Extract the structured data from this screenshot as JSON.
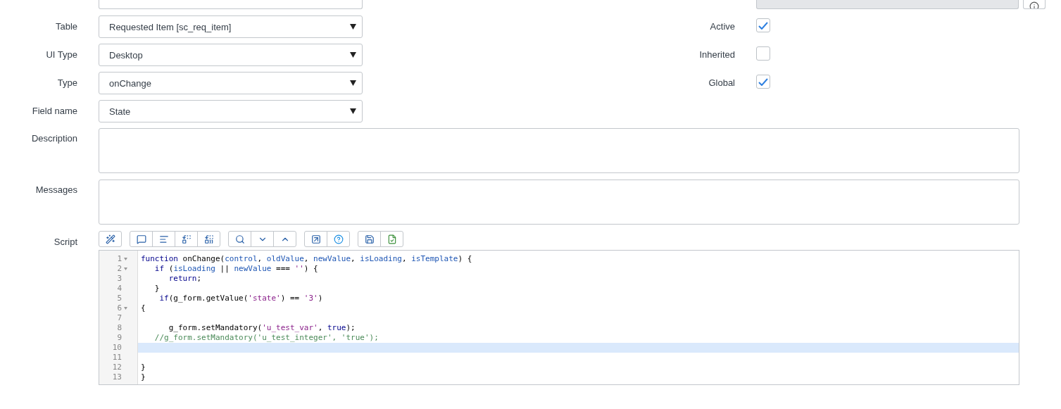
{
  "top_row": {
    "application_field": {
      "disabled": true
    }
  },
  "rows": [
    {
      "label": "Table",
      "select": "Requested Item [sc_req_item]",
      "right": {
        "label": "Active",
        "checked": true
      }
    },
    {
      "label": "UI Type",
      "select": "Desktop",
      "right": {
        "label": "Inherited",
        "checked": false
      }
    },
    {
      "label": "Type",
      "select": "onChange",
      "right": {
        "label": "Global",
        "checked": true
      }
    },
    {
      "label": "Field name",
      "select": "State"
    }
  ],
  "textareas": [
    {
      "label": "Description"
    },
    {
      "label": "Messages"
    }
  ],
  "script": {
    "label": "Script",
    "toolbar": [
      [
        {
          "kind": "format"
        }
      ],
      [
        {
          "kind": "comment"
        },
        {
          "kind": "align"
        },
        {
          "kind": "replace"
        },
        {
          "kind": "replace_all"
        }
      ],
      [
        {
          "kind": "search"
        },
        {
          "kind": "next"
        },
        {
          "kind": "previous"
        }
      ],
      [
        {
          "kind": "fullscreen"
        },
        {
          "kind": "help"
        }
      ],
      [
        {
          "kind": "save"
        },
        {
          "kind": "check"
        }
      ]
    ],
    "lines": [
      {
        "number": "1",
        "fold": true,
        "active": false,
        "tokens": [
          {
            "kind": "keyword",
            "text": "function"
          },
          {
            "kind": "plain",
            "text": " onChange("
          },
          {
            "kind": "var",
            "text": "control"
          },
          {
            "kind": "plain",
            "text": ", "
          },
          {
            "kind": "var",
            "text": "oldValue"
          },
          {
            "kind": "plain",
            "text": ", "
          },
          {
            "kind": "var",
            "text": "newValue"
          },
          {
            "kind": "plain",
            "text": ", "
          },
          {
            "kind": "var",
            "text": "isLoading"
          },
          {
            "kind": "plain",
            "text": ", "
          },
          {
            "kind": "var",
            "text": "isTemplate"
          },
          {
            "kind": "plain",
            "text": ") {"
          }
        ]
      },
      {
        "number": "2",
        "fold": true,
        "active": false,
        "tokens": [
          {
            "kind": "keyword",
            "text": "   if"
          },
          {
            "kind": "plain",
            "text": " ("
          },
          {
            "kind": "var",
            "text": "isLoading"
          },
          {
            "kind": "plain",
            "text": " || "
          },
          {
            "kind": "var",
            "text": "newValue"
          },
          {
            "kind": "plain",
            "text": " === "
          },
          {
            "kind": "string",
            "text": "''"
          },
          {
            "kind": "plain",
            "text": ") {"
          }
        ]
      },
      {
        "number": "3",
        "fold": false,
        "active": false,
        "tokens": [
          {
            "kind": "keyword",
            "text": "      return"
          },
          {
            "kind": "plain",
            "text": ";"
          }
        ]
      },
      {
        "number": "4",
        "fold": false,
        "active": false,
        "tokens": [
          {
            "kind": "plain",
            "text": "   }"
          }
        ]
      },
      {
        "number": "5",
        "fold": false,
        "active": false,
        "tokens": [
          {
            "kind": "keyword",
            "text": "    if"
          },
          {
            "kind": "plain",
            "text": "(g_form.getValue("
          },
          {
            "kind": "string",
            "text": "'state'"
          },
          {
            "kind": "plain",
            "text": ") == "
          },
          {
            "kind": "string",
            "text": "'3'"
          },
          {
            "kind": "plain",
            "text": ")"
          }
        ]
      },
      {
        "number": "6",
        "fold": true,
        "active": false,
        "tokens": [
          {
            "kind": "plain",
            "text": "{"
          }
        ]
      },
      {
        "number": "7",
        "fold": false,
        "active": false
      },
      {
        "number": "8",
        "fold": false,
        "active": false,
        "tokens": [
          {
            "kind": "plain",
            "text": "      g_form.setMandatory("
          },
          {
            "kind": "string",
            "text": "'u_test_var'"
          },
          {
            "kind": "plain",
            "text": ", "
          },
          {
            "kind": "keyword",
            "text": "true"
          },
          {
            "kind": "plain",
            "text": ");"
          }
        ]
      },
      {
        "number": "9",
        "fold": false,
        "active": false,
        "tokens": [
          {
            "kind": "comment",
            "text": "   //g_form.setMandatory('u_test_integer', 'true');"
          }
        ]
      },
      {
        "number": "10",
        "fold": false,
        "active": true
      },
      {
        "number": "11",
        "fold": false,
        "active": false
      },
      {
        "number": "12",
        "fold": false,
        "active": false,
        "tokens": [
          {
            "kind": "plain",
            "text": "}"
          }
        ]
      },
      {
        "number": "13",
        "fold": false,
        "active": false,
        "tokens": [
          {
            "kind": "plain",
            "text": "}"
          }
        ]
      }
    ]
  }
}
